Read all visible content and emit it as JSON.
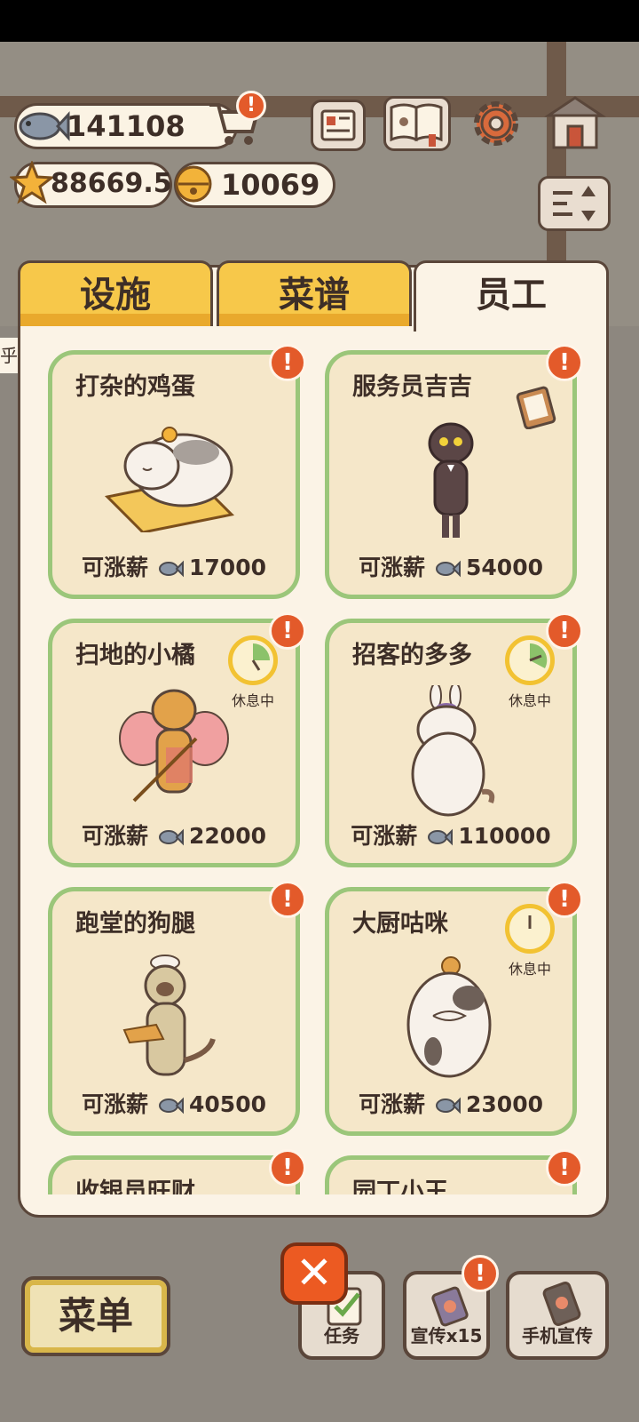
{
  "hud": {
    "fish_count": "141108",
    "star_count": "88669.5",
    "bell_count": "10069"
  },
  "top_icons": [
    "newspaper-icon",
    "recipe-book-icon",
    "settings-gear-icon",
    "shop-icon",
    "sort-icon"
  ],
  "tabs": [
    {
      "label": "设施",
      "active": false
    },
    {
      "label": "菜谱",
      "active": false
    },
    {
      "label": "员工",
      "active": true
    }
  ],
  "staff": [
    {
      "name": "打杂的鸡蛋",
      "salary_label": "可涨薪",
      "salary": "17000",
      "alert": "!",
      "resting": false
    },
    {
      "name": "服务员吉吉",
      "salary_label": "可涨薪",
      "salary": "54000",
      "alert": "!",
      "resting": false
    },
    {
      "name": "扫地的小橘",
      "salary_label": "可涨薪",
      "salary": "22000",
      "alert": "!",
      "resting": true,
      "rest_label": "休息中"
    },
    {
      "name": "招客的多多",
      "salary_label": "可涨薪",
      "salary": "110000",
      "alert": "!",
      "resting": true,
      "rest_label": "休息中"
    },
    {
      "name": "跑堂的狗腿",
      "salary_label": "可涨薪",
      "salary": "40500",
      "alert": "!",
      "resting": false
    },
    {
      "name": "大厨咕咪",
      "salary_label": "可涨薪",
      "salary": "23000",
      "alert": "!",
      "resting": true,
      "rest_label": "休息中"
    },
    {
      "name": "收银员旺财",
      "salary_label": "",
      "salary": "",
      "alert": "!",
      "resting": false
    },
    {
      "name": "园丁小王",
      "salary_label": "",
      "salary": "",
      "alert": "!",
      "resting": false
    }
  ],
  "bottom": {
    "menu_label": "菜单",
    "close_label": "✕",
    "task_label": "任务",
    "promo_label": "宣传x15",
    "phone_promo_label": "手机宣传",
    "promo_alert": "!"
  },
  "side_glyph": "乎"
}
